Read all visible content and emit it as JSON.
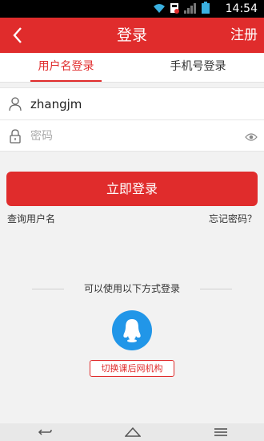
{
  "status_bar": {
    "time": "14:54"
  },
  "header": {
    "title": "登录",
    "register_label": "注册"
  },
  "tabs": [
    {
      "label": "用户名登录",
      "active": true
    },
    {
      "label": "手机号登录",
      "active": false
    }
  ],
  "form": {
    "username_value": "zhangjm",
    "password_placeholder": "密码"
  },
  "login_button": "立即登录",
  "links": {
    "find_username": "查询用户名",
    "forgot_password": "忘记密码？"
  },
  "alt_login": {
    "label": "可以使用以下方式登录",
    "provider_icon": "qq-icon"
  },
  "switch_button": "切换课后网机构",
  "colors": {
    "accent": "#e02c2c",
    "qq_blue": "#2196e8",
    "background": "#f2f2f2"
  }
}
